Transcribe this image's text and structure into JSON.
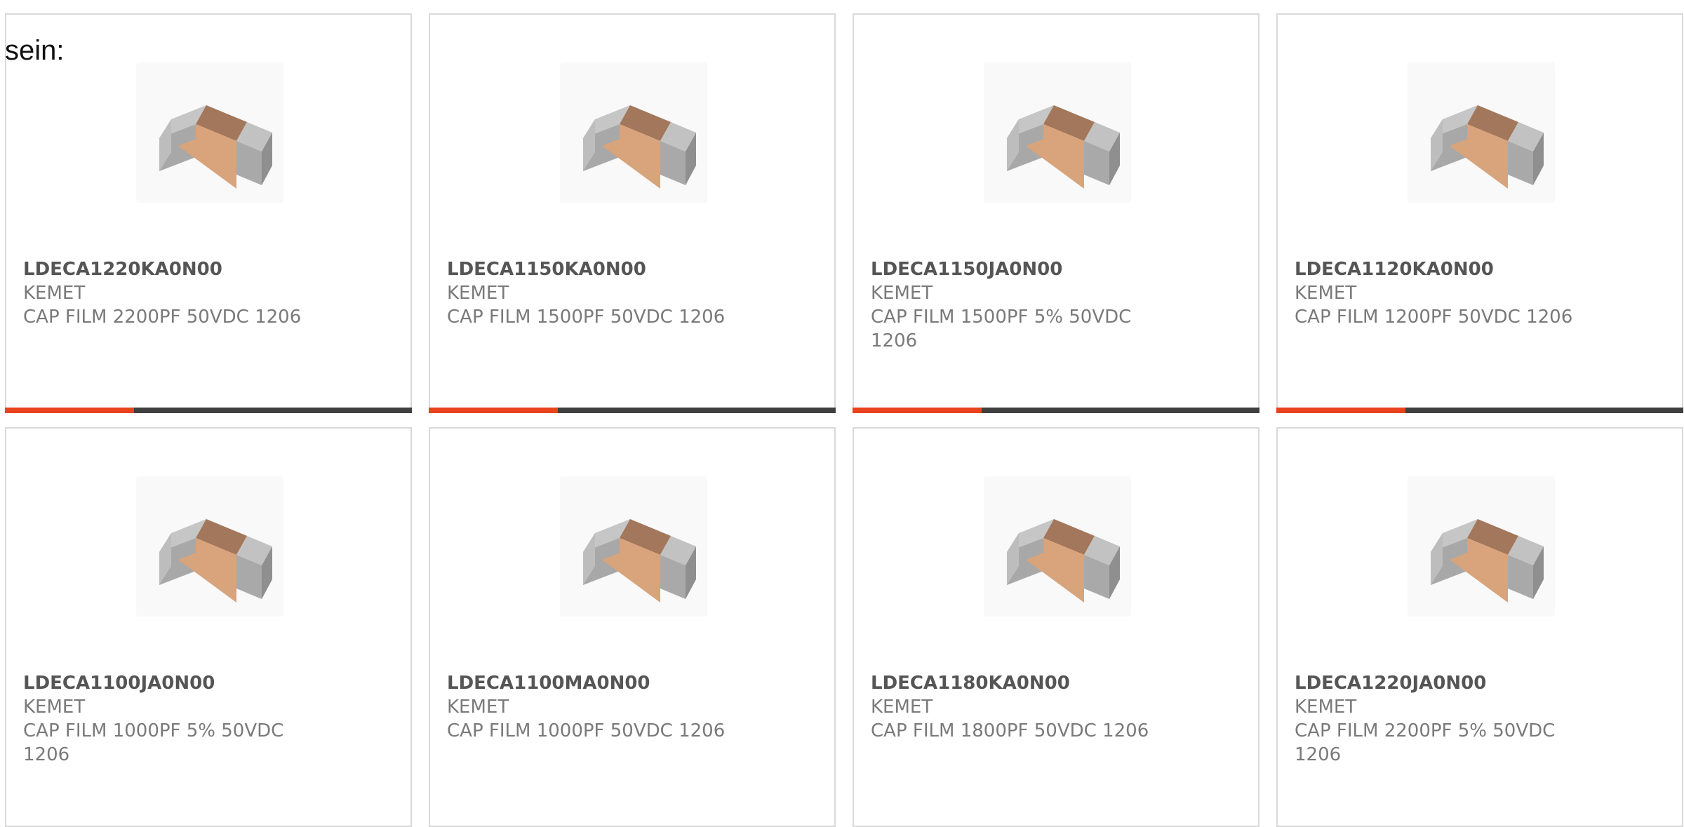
{
  "intro_text": "sein:",
  "colors": {
    "accent": "#e8431c",
    "bar_dark": "#3f3f3f",
    "border": "#d9d9d9"
  },
  "products": [
    {
      "part_number": "LDECA1220KA0N00",
      "manufacturer": "KEMET",
      "description": "CAP FILM 2200PF 50VDC 1206",
      "image": "capacitor-chip-image"
    },
    {
      "part_number": "LDECA1150KA0N00",
      "manufacturer": "KEMET",
      "description": "CAP FILM 1500PF 50VDC 1206",
      "image": "capacitor-chip-image"
    },
    {
      "part_number": "LDECA1150JA0N00",
      "manufacturer": "KEMET",
      "description": "CAP FILM 1500PF 5% 50VDC 1206",
      "image": "capacitor-chip-image"
    },
    {
      "part_number": "LDECA1120KA0N00",
      "manufacturer": "KEMET",
      "description": "CAP FILM 1200PF 50VDC 1206",
      "image": "capacitor-chip-image"
    },
    {
      "part_number": "LDECA1100JA0N00",
      "manufacturer": "KEMET",
      "description": "CAP FILM 1000PF 5% 50VDC 1206",
      "image": "capacitor-chip-image"
    },
    {
      "part_number": "LDECA1100MA0N00",
      "manufacturer": "KEMET",
      "description": "CAP FILM 1000PF 50VDC 1206",
      "image": "capacitor-chip-image"
    },
    {
      "part_number": "LDECA1180KA0N00",
      "manufacturer": "KEMET",
      "description": "CAP FILM 1800PF 50VDC 1206",
      "image": "capacitor-chip-image"
    },
    {
      "part_number": "LDECA1220JA0N00",
      "manufacturer": "KEMET",
      "description": "CAP FILM 2200PF 5% 50VDC 1206",
      "image": "capacitor-chip-image"
    }
  ]
}
